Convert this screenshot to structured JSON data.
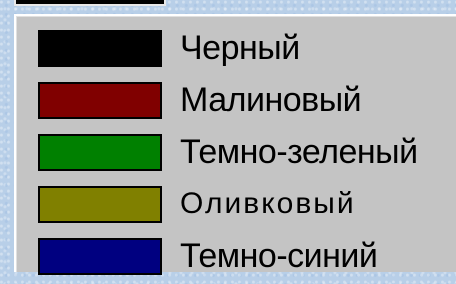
{
  "colors": [
    {
      "name": "Черный",
      "hex": "#000000"
    },
    {
      "name": "Малиновый",
      "hex": "#800000"
    },
    {
      "name": "Темно-зеленый",
      "hex": "#008000"
    },
    {
      "name": "Оливковый",
      "hex": "#808000"
    },
    {
      "name": "Темно-синий",
      "hex": "#000080"
    }
  ]
}
